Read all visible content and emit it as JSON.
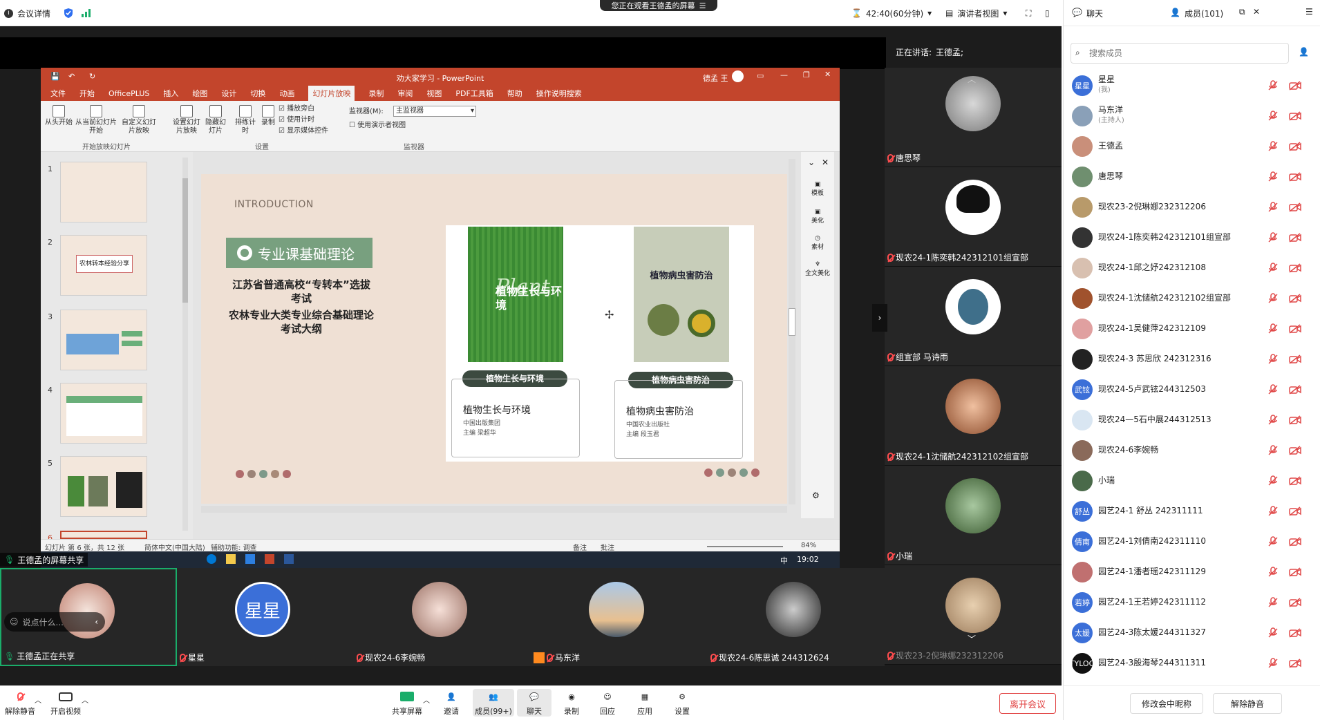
{
  "topbar": {
    "meeting_info": "会议详情",
    "banner": "您正在观看王德孟的屏幕",
    "timer": "42:40(60分钟)",
    "view_mode": "演讲者视图"
  },
  "ppt": {
    "title": "劝大家学习 - PowerPoint",
    "user": "德孟 王",
    "tabs": [
      "文件",
      "开始",
      "OfficePLUS",
      "插入",
      "绘图",
      "设计",
      "切换",
      "动画",
      "幻灯片放映",
      "录制",
      "审阅",
      "视图",
      "PDF工具箱",
      "帮助",
      "操作说明搜索"
    ],
    "ribbon": {
      "from_start": "从头开始",
      "from_current": "从当前幻灯片开始",
      "custom": "自定义幻灯片放映",
      "group1": "开始放映幻灯片",
      "setup": "设置幻灯片放映",
      "hide": "隐藏幻灯片",
      "rehearse": "排练计时",
      "record": "录制",
      "cb_narration": "播放旁白",
      "cb_timing": "使用计时",
      "cb_media": "显示媒体控件",
      "group2": "设置",
      "monitor_label": "监视器(M):",
      "monitor_value": "主监视器",
      "presenter_view": "使用演示者视图",
      "group3": "监视器"
    },
    "thumb_numbers": [
      "1",
      "2",
      "3",
      "4",
      "5",
      "6"
    ],
    "thumb2_text": "农林转本经验分享",
    "slide": {
      "intro": "INTRODUCTION",
      "heading": "专业课基础理论",
      "line1": "江苏省普通高校“专转本”选拔考试",
      "line2": "农林专业大类专业综合基础理论考试大纲",
      "book1": {
        "cover_title": "植物生长与环境",
        "cover_en": "Plant",
        "tag": "植物生长与环境",
        "name": "植物生长与环境",
        "publisher": "中国出版集团",
        "editor": "主编 梁超华"
      },
      "book2": {
        "cover_title": "植物病虫害防治",
        "tag": "植物病虫害防治",
        "name": "植物病虫害防治",
        "publisher": "中国农业出版社",
        "editor": "主编 段玉君"
      }
    },
    "side_panel": [
      "模板",
      "美化",
      "素材",
      "全文美化"
    ],
    "status": {
      "slide_info": "幻灯片 第 6 张，共 12 张",
      "lang": "简体中文(中国大陆)",
      "accessibility": "辅助功能: 调查",
      "notes": "备注",
      "comments": "批注",
      "zoom": "84%"
    },
    "taskbar": {
      "time": "19:02",
      "ime": "中"
    }
  },
  "share_label": "王德孟的屏幕共享",
  "chat_placeholder": "说点什么...",
  "speaking": {
    "label": "正在讲话:",
    "name": "王德孟;"
  },
  "right_videos": [
    "唐思琴",
    "现农24-1陈奕韩242312101组宣部",
    "组宣部 马诗雨",
    "现农24-1沈储航242312102组宣部",
    "小瑞",
    "现农23-2倪琳娜232312206"
  ],
  "bottom_videos": [
    "王德孟正在共享",
    "星星",
    "现农24-6李婉畅",
    "马东洋",
    "现农24-6陈思诚 244312624"
  ],
  "bottom_avatar_text": "星星",
  "toolbar": {
    "unmute": "解除静音",
    "start_video": "开启视频",
    "share": "共享屏幕",
    "invite": "邀请",
    "members": "成员(99+)",
    "chat": "聊天",
    "record": "录制",
    "reactions": "回应",
    "apps": "应用",
    "settings": "设置",
    "leave": "离开会议"
  },
  "panel": {
    "chat_tab": "聊天",
    "members_tab": "成员(101)",
    "search_placeholder": "搜索成员",
    "members": [
      {
        "name": "星星",
        "sub": "(我)",
        "av": "星星",
        "color": "#3b6fd8"
      },
      {
        "name": "马东洋",
        "sub": "(主持人)",
        "av": "",
        "color": "#8aa0b8"
      },
      {
        "name": "王德孟",
        "sub": "",
        "av": "",
        "color": "#c98f7a"
      },
      {
        "name": "唐思琴",
        "sub": "",
        "av": "",
        "color": "#6f8f6f"
      },
      {
        "name": "现农23-2倪琳娜232312206",
        "sub": "",
        "av": "",
        "color": "#b89a6a"
      },
      {
        "name": "现农24-1陈奕韩242312101组宣部",
        "sub": "",
        "av": "",
        "color": "#333333"
      },
      {
        "name": "现农24-1邱之妤242312108",
        "sub": "",
        "av": "",
        "color": "#d8c0b0"
      },
      {
        "name": "现农24-1沈储航242312102组宣部",
        "sub": "",
        "av": "",
        "color": "#a0522d"
      },
      {
        "name": "现农24-1吴健萍242312109",
        "sub": "",
        "av": "",
        "color": "#e0a0a0"
      },
      {
        "name": "现农24-3 苏思欣 242312316",
        "sub": "",
        "av": "",
        "color": "#222222"
      },
      {
        "name": "现农24-5卢武铉244312503",
        "sub": "",
        "av": "武铉",
        "color": "#3b6fd8"
      },
      {
        "name": "现农24—5石中展244312513",
        "sub": "",
        "av": "",
        "color": "#d9e6f2"
      },
      {
        "name": "现农24-6李婉畅",
        "sub": "",
        "av": "",
        "color": "#8a6a5a"
      },
      {
        "name": "小瑞",
        "sub": "",
        "av": "",
        "color": "#4a6a4a"
      },
      {
        "name": "园艺24-1 舒丛 242311111",
        "sub": "",
        "av": "舒丛",
        "color": "#3b6fd8"
      },
      {
        "name": "园艺24-1刘倩南242311110",
        "sub": "",
        "av": "倩南",
        "color": "#3b6fd8"
      },
      {
        "name": "园艺24-1潘者瑶242311129",
        "sub": "",
        "av": "",
        "color": "#c07070"
      },
      {
        "name": "园艺24-1王若婷242311112",
        "sub": "",
        "av": "若婷",
        "color": "#3b6fd8"
      },
      {
        "name": "园艺24-3陈太媛244311327",
        "sub": "",
        "av": "太媛",
        "color": "#3b6fd8"
      },
      {
        "name": "园艺24-3殷海琴244311311",
        "sub": "",
        "av": "TYLOO",
        "color": "#111111"
      }
    ],
    "rename": "修改会中昵称",
    "unmute_all": "解除静音"
  }
}
